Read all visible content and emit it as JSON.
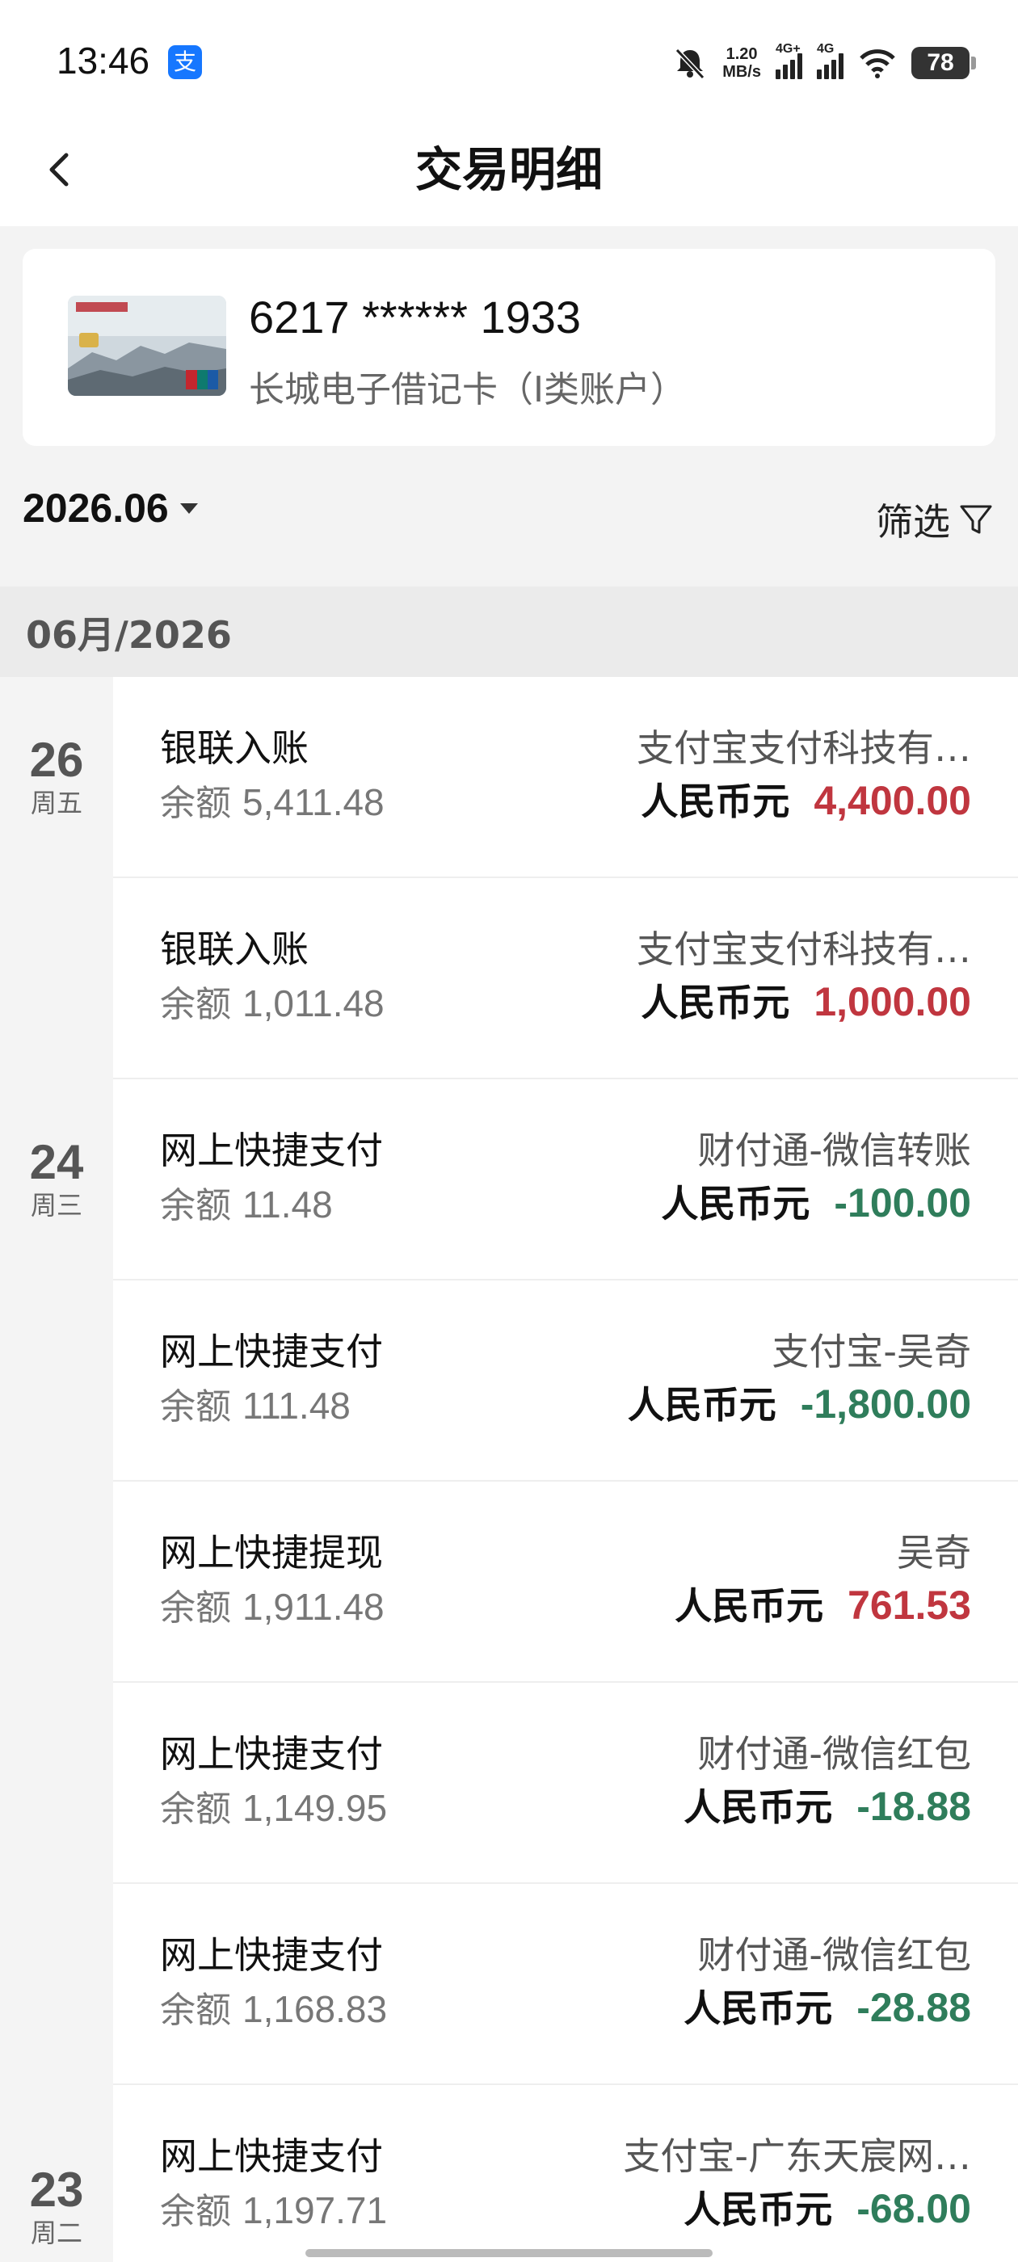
{
  "status_bar": {
    "time": "13:46",
    "app_icon": "支",
    "net_speed_value": "1.20",
    "net_speed_unit": "MB/s",
    "signal1_label": "4G+",
    "signal2_label": "4G",
    "battery": "78",
    "icons": [
      "alipay-icon",
      "mute-bell-icon",
      "signal-icon",
      "wifi-icon",
      "battery-icon"
    ]
  },
  "header": {
    "title": "交易明细",
    "back_icon": "chevron-left-icon"
  },
  "card": {
    "number": "6217 ****** 1933",
    "name": "长城电子借记卡（I类账户）"
  },
  "filter_bar": {
    "month": "2026.06",
    "filter_label": "筛选"
  },
  "month_header": "06月/2026",
  "days": [
    {
      "day": "26",
      "weekday": "周五"
    },
    {
      "day": "24",
      "weekday": "周三"
    },
    {
      "day": "23",
      "weekday": "周二"
    }
  ],
  "balance_label": "余额",
  "currency_label": "人民币元",
  "transactions": [
    {
      "type": "银联入账",
      "balance": "5,411.48",
      "party": "支付宝支付科技有…",
      "amount": "4,400.00",
      "direction": "in"
    },
    {
      "type": "银联入账",
      "balance": "1,011.48",
      "party": "支付宝支付科技有…",
      "amount": "1,000.00",
      "direction": "in"
    },
    {
      "type": "网上快捷支付",
      "balance": "11.48",
      "party": "财付通-微信转账",
      "amount": "-100.00",
      "direction": "out"
    },
    {
      "type": "网上快捷支付",
      "balance": "111.48",
      "party": "支付宝-吴奇",
      "amount": "-1,800.00",
      "direction": "out"
    },
    {
      "type": "网上快捷提现",
      "balance": "1,911.48",
      "party": "吴奇",
      "amount": "761.53",
      "direction": "in"
    },
    {
      "type": "网上快捷支付",
      "balance": "1,149.95",
      "party": "财付通-微信红包",
      "amount": "-18.88",
      "direction": "out"
    },
    {
      "type": "网上快捷支付",
      "balance": "1,168.83",
      "party": "财付通-微信红包",
      "amount": "-28.88",
      "direction": "out"
    },
    {
      "type": "网上快捷支付",
      "balance": "1,197.71",
      "party": "支付宝-广东天宸网…",
      "amount": "-68.00",
      "direction": "out"
    }
  ],
  "colors": {
    "income": "#c0363f",
    "expense": "#2f7d5b",
    "background": "#f3f3f3"
  }
}
